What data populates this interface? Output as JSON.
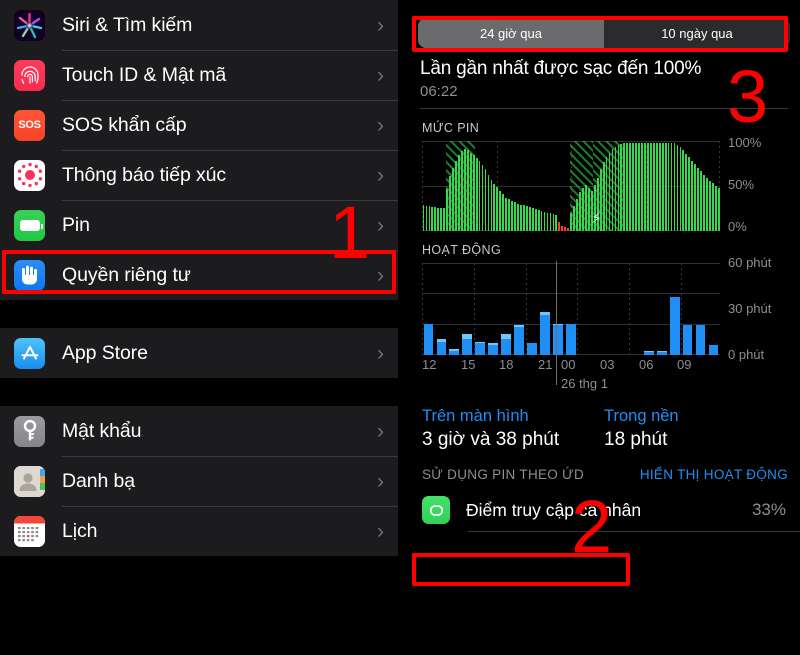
{
  "left_panel": {
    "groups": [
      {
        "items": [
          {
            "label": "Siri & Tìm kiếm",
            "icon": "siri-icon"
          },
          {
            "label": "Touch ID & Mật mã",
            "icon": "touchid-icon"
          },
          {
            "label": "SOS khẩn cấp",
            "icon": "sos-icon",
            "icon_text": "SOS"
          },
          {
            "label": "Thông báo tiếp xúc",
            "icon": "exposure-notification-icon"
          },
          {
            "label": "Pin",
            "icon": "battery-icon"
          },
          {
            "label": "Quyền riêng tư",
            "icon": "privacy-hand-icon"
          }
        ]
      },
      {
        "items": [
          {
            "label": "App Store",
            "icon": "app-store-icon"
          }
        ]
      },
      {
        "items": [
          {
            "label": "Mật khẩu",
            "icon": "passwords-key-icon"
          },
          {
            "label": "Danh bạ",
            "icon": "contacts-icon"
          },
          {
            "label": "Lịch",
            "icon": "calendar-icon"
          }
        ]
      }
    ],
    "chevron": "›"
  },
  "right_panel": {
    "tabs": [
      {
        "label": "24 giờ qua",
        "active": true
      },
      {
        "label": "10 ngày qua",
        "active": false
      }
    ],
    "last_charge_title": "Lần gần nhất được sạc đến 100%",
    "last_charge_time": "06:22",
    "battery_section_header": "MỨC PIN",
    "activity_section_header": "HOẠT ĐỘNG",
    "usage": [
      {
        "label": "Trên màn hình",
        "value": "3 giờ và 38 phút"
      },
      {
        "label": "Trong nền",
        "value": "18 phút"
      }
    ],
    "apps_section_header": "SỬ DỤNG PIN THEO ỨD",
    "show_activity_link": "HIỂN THỊ HOẠT ĐỘNG",
    "apps": [
      {
        "name": "Điểm truy cập cá nhân",
        "percent": "33%",
        "icon": "personal-hotspot-icon"
      }
    ],
    "bolt_glyph": "⚡"
  },
  "annotations": [
    {
      "id": "1",
      "label": "1",
      "target": "pin-row"
    },
    {
      "id": "2",
      "label": "2",
      "target": "usage-summary"
    },
    {
      "id": "3",
      "label": "3",
      "target": "time-range-tabs"
    }
  ],
  "colors": {
    "accent_blue": "#1f8ff5",
    "battery_green": "#35d94e",
    "battery_red": "#ff3b30",
    "annotation_red": "#ff0000",
    "secondary_text": "#8e8e93",
    "row_bg": "#1c1c1e"
  },
  "chart_data": [
    {
      "type": "bar",
      "name": "battery-level-chart",
      "title": "MỨC PIN",
      "xlabel": "",
      "ylabel": "",
      "ylim": [
        0,
        100
      ],
      "ytick_labels": [
        "100%",
        "50%",
        "0%"
      ],
      "ytick_values": [
        100,
        50,
        0
      ],
      "grid": true,
      "unit": "%",
      "values": [
        30,
        28,
        28,
        27,
        27,
        26,
        26,
        26,
        48,
        62,
        72,
        80,
        86,
        91,
        93,
        92,
        89,
        86,
        83,
        79,
        75,
        70,
        64,
        58,
        53,
        50,
        46,
        42,
        38,
        36,
        34,
        33,
        31,
        30,
        29,
        28,
        27,
        26,
        25,
        24,
        23,
        22,
        21,
        20,
        19,
        18,
        10,
        6,
        4,
        3,
        20,
        28,
        36,
        44,
        49,
        52,
        49,
        46,
        52,
        60,
        70,
        78,
        84,
        89,
        93,
        96,
        98,
        99,
        100,
        100,
        100,
        100,
        100,
        100,
        100,
        100,
        100,
        100,
        100,
        100,
        100,
        100,
        100,
        100,
        100,
        100,
        98,
        95,
        92,
        88,
        84,
        80,
        76,
        72,
        68,
        64,
        60,
        57,
        54,
        51,
        49
      ],
      "bar_colors_note": "green except low-battery bars rendered red",
      "red_bar_indices": [
        46,
        47,
        48,
        49
      ],
      "charging_regions": [
        {
          "start_index": 8,
          "end_index": 17
        },
        {
          "start_index": 50,
          "end_index": 57
        },
        {
          "start_index": 58,
          "end_index": 67
        }
      ],
      "charging_bolt_index": 58
    },
    {
      "type": "bar",
      "name": "activity-chart",
      "title": "HOẠT ĐỘNG",
      "xlabel": "",
      "ylabel": "",
      "ylim": [
        0,
        60
      ],
      "ytick_labels": [
        "60 phút",
        "30 phút",
        "0 phút"
      ],
      "ytick_values": [
        60,
        30,
        0
      ],
      "grid": true,
      "unit": "phút",
      "categories": [
        "12",
        "13",
        "14",
        "15",
        "16",
        "17",
        "18",
        "19",
        "20",
        "21",
        "22",
        "23",
        "00",
        "01",
        "02",
        "03",
        "04",
        "05",
        "06",
        "07",
        "08",
        "09",
        "10"
      ],
      "tick_labels": [
        "12",
        "15",
        "18",
        "21",
        "00",
        "03",
        "06",
        "09"
      ],
      "day_divider_label": "26 thg 1",
      "series": [
        {
          "name": "Trên màn hình",
          "values": [
            21,
            9,
            3,
            11,
            8,
            7,
            11,
            19,
            8,
            27,
            20,
            21,
            0,
            0,
            0,
            0,
            0,
            2,
            2,
            39,
            20,
            20,
            7
          ]
        },
        {
          "name": "Trong nền",
          "values": [
            0,
            2,
            1,
            3,
            1,
            1,
            3,
            1,
            0,
            2,
            1,
            0,
            0,
            0,
            0,
            0,
            0,
            1,
            1,
            0,
            0,
            0,
            0
          ]
        }
      ]
    }
  ]
}
